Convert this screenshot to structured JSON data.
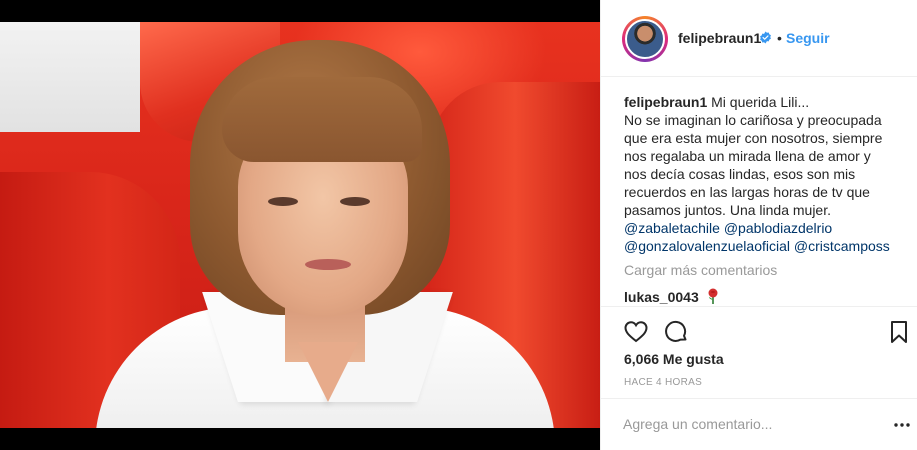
{
  "post": {
    "username": "felipebraun1",
    "verified_icon": "verified-badge-icon",
    "separator": "•",
    "follow_label": "Seguir"
  },
  "caption": {
    "username": "felipebraun1",
    "lines": [
      "Mi querida Lili...",
      "No se imaginan lo cariñosa y preocupada",
      "que era esta mujer con nosotros, siempre",
      "nos regalaba un mirada llena de amor y",
      "nos decía cosas lindas, esos son mis",
      "recuerdos en las largas horas de tv que",
      "pasamos juntos. Una linda mujer."
    ],
    "mentions": [
      "@zabaletachile",
      "@pablodiazdelrio",
      "@gonzalovalenzuelaoficial",
      "@cristcamposs"
    ]
  },
  "comments": {
    "load_more": "Cargar más comentarios",
    "items": [
      {
        "username": "lukas_0043",
        "emoji_icon": "rose-icon"
      }
    ]
  },
  "actions": {
    "likes": "6,066 Me gusta",
    "timestamp": "HACE 4 HORAS"
  },
  "add_comment": {
    "placeholder": "Agrega un comentario..."
  },
  "colors": {
    "link_blue": "#3897f0",
    "mention": "#003569",
    "muted": "#999999",
    "text": "#262626",
    "border": "#efefef"
  }
}
